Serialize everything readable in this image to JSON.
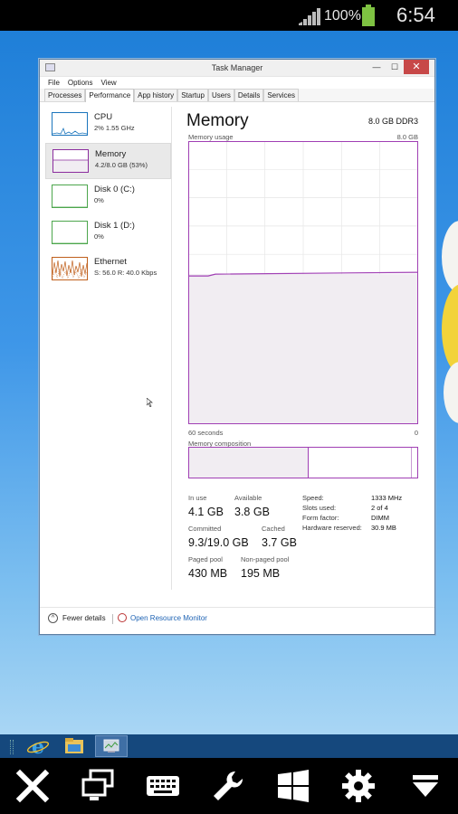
{
  "status_bar": {
    "battery_percent": "100%",
    "clock": "6:54",
    "signal_icon": "signal-icon",
    "battery_icon": "battery-icon"
  },
  "window": {
    "title": "Task Manager",
    "menu": [
      "File",
      "Options",
      "View"
    ],
    "tabs": [
      "Processes",
      "Performance",
      "App history",
      "Startup",
      "Users",
      "Details",
      "Services"
    ],
    "active_tab": "Performance"
  },
  "sidebar": {
    "items": [
      {
        "name": "CPU",
        "detail": "2%  1.55 GHz",
        "color": "#1b75bc"
      },
      {
        "name": "Memory",
        "detail": "4.2/8.0 GB (53%)",
        "color": "#8b2d9e"
      },
      {
        "name": "Disk 0 (C:)",
        "detail": "0%",
        "color": "#4ca64c"
      },
      {
        "name": "Disk 1 (D:)",
        "detail": "0%",
        "color": "#4ca64c"
      },
      {
        "name": "Ethernet",
        "detail": "S: 56.0  R: 40.0 Kbps",
        "color": "#c0601c"
      }
    ],
    "active_index": 1
  },
  "main": {
    "title": "Memory",
    "spec": "8.0 GB DDR3",
    "usage_label": "Memory usage",
    "usage_max": "8.0 GB",
    "time_label": "60 seconds",
    "time_end": "0",
    "composition_label": "Memory composition",
    "accent": "#a03fb4",
    "in_use_label": "In use",
    "in_use": "4.1 GB",
    "available_label": "Available",
    "available": "3.8 GB",
    "committed_label": "Committed",
    "committed": "9.3/19.0 GB",
    "cached_label": "Cached",
    "cached": "3.7 GB",
    "paged_label": "Paged pool",
    "paged": "430 MB",
    "nonpaged_label": "Non-paged pool",
    "nonpaged": "195 MB",
    "hw": {
      "speed_label": "Speed:",
      "speed": "1333 MHz",
      "slots_label": "Slots used:",
      "slots": "2 of 4",
      "form_label": "Form factor:",
      "form": "DIMM",
      "reserved_label": "Hardware reserved:",
      "reserved": "30.9 MB"
    }
  },
  "footer": {
    "fewer": "Fewer details",
    "monitor": "Open Resource Monitor"
  },
  "taskbar": {
    "items": [
      "internet-explorer-icon",
      "file-explorer-icon",
      "task-manager-icon"
    ]
  },
  "control_bar": {
    "items": [
      "close-icon",
      "switch-screen-icon",
      "keyboard-icon",
      "wrench-icon",
      "windows-icon",
      "settings-icon",
      "dropdown-icon"
    ]
  },
  "memory_usage_fraction": 0.53
}
